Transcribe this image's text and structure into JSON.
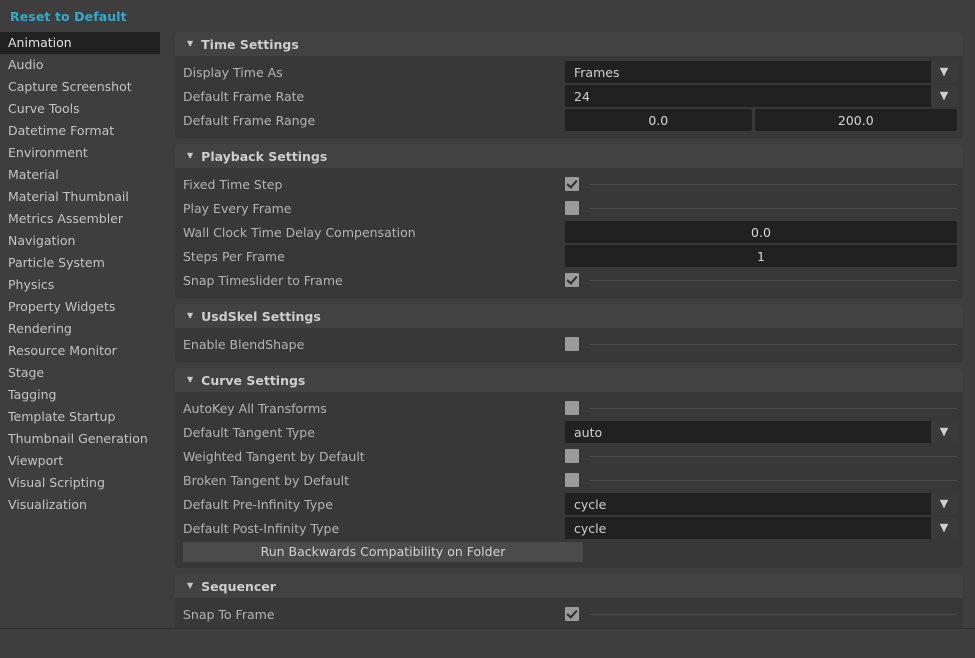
{
  "top": {
    "reset_label": "Reset to Default"
  },
  "sidebar": {
    "items": [
      {
        "label": "Animation",
        "selected": true
      },
      {
        "label": "Audio",
        "selected": false
      },
      {
        "label": "Capture Screenshot",
        "selected": false
      },
      {
        "label": "Curve Tools",
        "selected": false
      },
      {
        "label": "Datetime Format",
        "selected": false
      },
      {
        "label": "Environment",
        "selected": false
      },
      {
        "label": "Material",
        "selected": false
      },
      {
        "label": "Material Thumbnail",
        "selected": false
      },
      {
        "label": "Metrics Assembler",
        "selected": false
      },
      {
        "label": "Navigation",
        "selected": false
      },
      {
        "label": "Particle System",
        "selected": false
      },
      {
        "label": "Physics",
        "selected": false
      },
      {
        "label": "Property Widgets",
        "selected": false
      },
      {
        "label": "Rendering",
        "selected": false
      },
      {
        "label": "Resource Monitor",
        "selected": false
      },
      {
        "label": "Stage",
        "selected": false
      },
      {
        "label": "Tagging",
        "selected": false
      },
      {
        "label": "Template Startup",
        "selected": false
      },
      {
        "label": "Thumbnail Generation",
        "selected": false
      },
      {
        "label": "Viewport",
        "selected": false
      },
      {
        "label": "Visual Scripting",
        "selected": false
      },
      {
        "label": "Visualization",
        "selected": false
      }
    ]
  },
  "icons": {
    "collapse_caret": "▼",
    "dropdown_caret": "▼"
  },
  "groups": {
    "time_settings": {
      "title": "Time Settings",
      "rows": {
        "display_time_as": {
          "label": "Display Time As",
          "value": "Frames"
        },
        "default_frame_rate": {
          "label": "Default Frame Rate",
          "value": "24"
        },
        "default_frame_range": {
          "label": "Default Frame Range",
          "min": "0.0",
          "max": "200.0"
        }
      }
    },
    "playback_settings": {
      "title": "Playback Settings",
      "rows": {
        "fixed_time_step": {
          "label": "Fixed Time Step",
          "checked": true
        },
        "play_every_frame": {
          "label": "Play Every Frame",
          "checked": false
        },
        "wall_clock": {
          "label": "Wall Clock Time Delay Compensation",
          "value": "0.0"
        },
        "steps_per_frame": {
          "label": "Steps Per Frame",
          "value": "1"
        },
        "snap_timeslider": {
          "label": "Snap Timeslider to Frame",
          "checked": true
        }
      }
    },
    "usdskel_settings": {
      "title": "UsdSkel Settings",
      "rows": {
        "enable_blendshape": {
          "label": "Enable BlendShape",
          "checked": false
        }
      }
    },
    "curve_settings": {
      "title": "Curve Settings",
      "rows": {
        "autokey_all": {
          "label": "AutoKey All Transforms",
          "checked": false
        },
        "default_tangent": {
          "label": "Default Tangent Type",
          "value": "auto"
        },
        "weighted_tangent": {
          "label": "Weighted Tangent by Default",
          "checked": false
        },
        "broken_tangent": {
          "label": "Broken Tangent by Default",
          "checked": false
        },
        "pre_infinity": {
          "label": "Default Pre-Infinity Type",
          "value": "cycle"
        },
        "post_infinity": {
          "label": "Default Post-Infinity Type",
          "value": "cycle"
        },
        "run_backwards_button": {
          "label": "Run Backwards Compatibility on Folder"
        }
      }
    },
    "sequencer": {
      "title": "Sequencer",
      "rows": {
        "snap_to_frame": {
          "label": "Snap To Frame",
          "checked": true
        }
      }
    }
  },
  "colors": {
    "window_bg": "#3e3e3e",
    "group_bg": "#383838",
    "group_header_bg": "#424242",
    "field_bg": "#212121",
    "accent_link": "#34a9d4",
    "selected_item_bg": "#212121",
    "checkbox_bg": "#9a9a9a"
  }
}
